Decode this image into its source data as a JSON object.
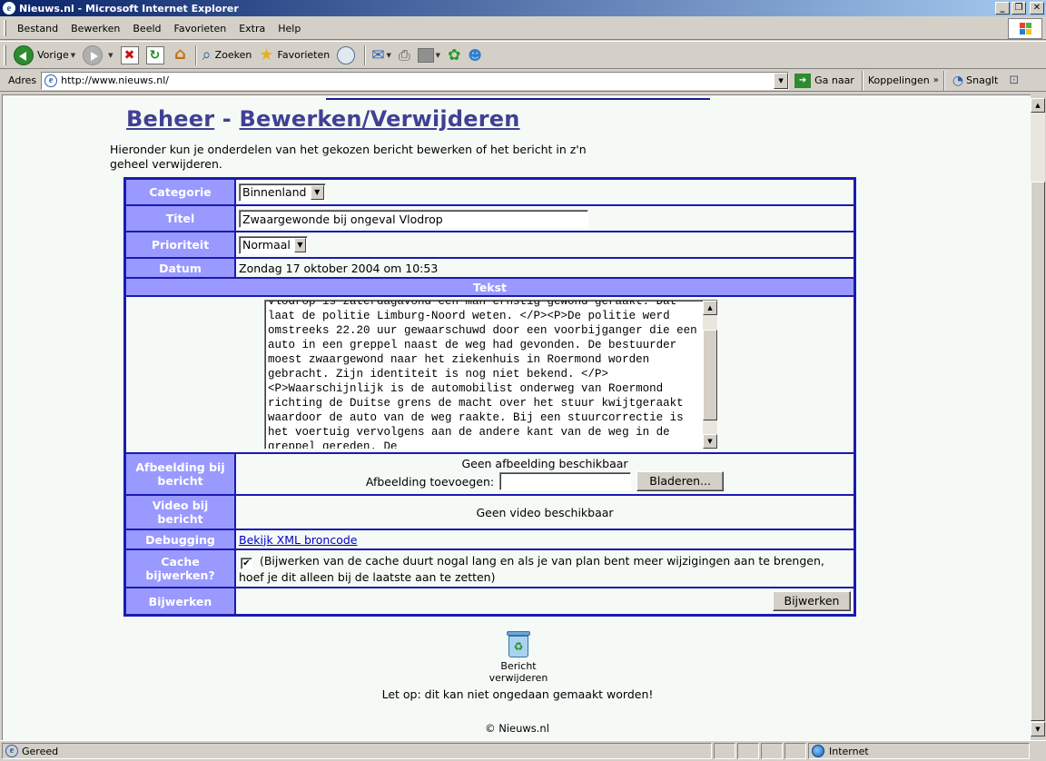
{
  "window": {
    "title": "Nieuws.nl - Microsoft Internet Explorer",
    "minimize": "_",
    "maximize": "❐",
    "close": "✕"
  },
  "menu": [
    "Bestand",
    "Bewerken",
    "Beeld",
    "Favorieten",
    "Extra",
    "Help"
  ],
  "toolbar": {
    "back": "Vorige",
    "search": "Zoeken",
    "favorites": "Favorieten"
  },
  "address": {
    "label": "Adres",
    "url": "http://www.nieuws.nl/",
    "go": "Ga naar",
    "links": "Koppelingen",
    "snagit": "SnagIt"
  },
  "page": {
    "heading_part1": "Beheer",
    "heading_sep": " - ",
    "heading_part2": "Bewerken/Verwijderen",
    "intro": "Hieronder kun je onderdelen van het gekozen bericht bewerken of het bericht in z'n geheel verwijderen.",
    "form": {
      "categorie_label": "Categorie",
      "categorie_value": "Binnenland",
      "titel_label": "Titel",
      "titel_value": "Zwaargewonde bij ongeval Vlodrop",
      "prioriteit_label": "Prioriteit",
      "prioriteit_value": "Normaal",
      "datum_label": "Datum",
      "datum_value": "Zondag 17 oktober 2004 om 10:53",
      "tekst_label": "Tekst",
      "tekst_value": "Vlodrop is zaterdagavond een man ernstig gewond geraakt. Dat laat de politie Limburg-Noord weten. </P><P>De politie werd omstreeks 22.20 uur gewaarschuwd door een voorbijganger die een auto in een greppel naast de weg had gevonden. De bestuurder moest zwaargewond naar het ziekenhuis in Roermond worden gebracht. Zijn identiteit is nog niet bekend. </P><P>Waarschijnlijk is de automobilist onderweg van Roermond richting de Duitse grens de macht over het stuur kwijtgeraakt waardoor de auto van de weg raakte. Bij een stuurcorrectie is het voertuig vervolgens aan de andere kant van de weg in de greppel gereden. De",
      "afbeelding_label": "Afbeelding bij bericht",
      "afbeelding_status": "Geen afbeelding beschikbaar",
      "afbeelding_add_label": "Afbeelding toevoegen:",
      "browse_button": "Bladeren...",
      "video_label": "Video bij bericht",
      "video_status": "Geen video beschikbaar",
      "debug_label": "Debugging",
      "debug_link": "Bekijk XML broncode",
      "cache_label": "Cache bijwerken?",
      "cache_text": "(Bijwerken van de cache duurt nogal lang en als je van plan bent meer wijzigingen aan te brengen, hoef je dit alleen bij de laatste aan te zetten)",
      "submit_label": "Bijwerken",
      "submit_button": "Bijwerken"
    },
    "delete_label": "Bericht verwijderen",
    "warning": "Let op: dit kan niet ongedaan gemaakt worden!",
    "copyright": "© Nieuws.nl"
  },
  "status": {
    "text": "Gereed",
    "zone": "Internet"
  }
}
